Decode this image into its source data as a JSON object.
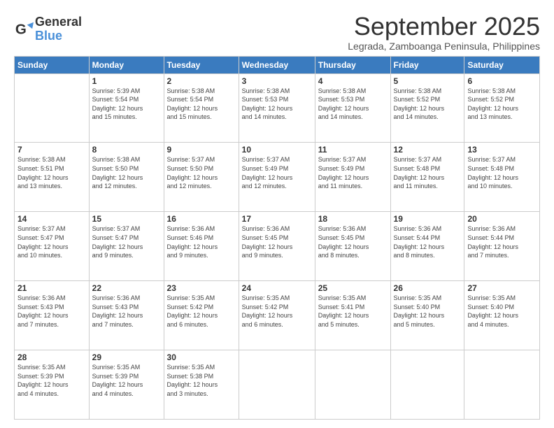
{
  "logo": {
    "line1": "General",
    "line2": "Blue"
  },
  "title": "September 2025",
  "subtitle": "Legrada, Zamboanga Peninsula, Philippines",
  "headers": [
    "Sunday",
    "Monday",
    "Tuesday",
    "Wednesday",
    "Thursday",
    "Friday",
    "Saturday"
  ],
  "weeks": [
    [
      {
        "day": "",
        "info": ""
      },
      {
        "day": "1",
        "info": "Sunrise: 5:39 AM\nSunset: 5:54 PM\nDaylight: 12 hours\nand 15 minutes."
      },
      {
        "day": "2",
        "info": "Sunrise: 5:38 AM\nSunset: 5:54 PM\nDaylight: 12 hours\nand 15 minutes."
      },
      {
        "day": "3",
        "info": "Sunrise: 5:38 AM\nSunset: 5:53 PM\nDaylight: 12 hours\nand 14 minutes."
      },
      {
        "day": "4",
        "info": "Sunrise: 5:38 AM\nSunset: 5:53 PM\nDaylight: 12 hours\nand 14 minutes."
      },
      {
        "day": "5",
        "info": "Sunrise: 5:38 AM\nSunset: 5:52 PM\nDaylight: 12 hours\nand 14 minutes."
      },
      {
        "day": "6",
        "info": "Sunrise: 5:38 AM\nSunset: 5:52 PM\nDaylight: 12 hours\nand 13 minutes."
      }
    ],
    [
      {
        "day": "7",
        "info": "Sunrise: 5:38 AM\nSunset: 5:51 PM\nDaylight: 12 hours\nand 13 minutes."
      },
      {
        "day": "8",
        "info": "Sunrise: 5:38 AM\nSunset: 5:50 PM\nDaylight: 12 hours\nand 12 minutes."
      },
      {
        "day": "9",
        "info": "Sunrise: 5:37 AM\nSunset: 5:50 PM\nDaylight: 12 hours\nand 12 minutes."
      },
      {
        "day": "10",
        "info": "Sunrise: 5:37 AM\nSunset: 5:49 PM\nDaylight: 12 hours\nand 12 minutes."
      },
      {
        "day": "11",
        "info": "Sunrise: 5:37 AM\nSunset: 5:49 PM\nDaylight: 12 hours\nand 11 minutes."
      },
      {
        "day": "12",
        "info": "Sunrise: 5:37 AM\nSunset: 5:48 PM\nDaylight: 12 hours\nand 11 minutes."
      },
      {
        "day": "13",
        "info": "Sunrise: 5:37 AM\nSunset: 5:48 PM\nDaylight: 12 hours\nand 10 minutes."
      }
    ],
    [
      {
        "day": "14",
        "info": "Sunrise: 5:37 AM\nSunset: 5:47 PM\nDaylight: 12 hours\nand 10 minutes."
      },
      {
        "day": "15",
        "info": "Sunrise: 5:37 AM\nSunset: 5:47 PM\nDaylight: 12 hours\nand 9 minutes."
      },
      {
        "day": "16",
        "info": "Sunrise: 5:36 AM\nSunset: 5:46 PM\nDaylight: 12 hours\nand 9 minutes."
      },
      {
        "day": "17",
        "info": "Sunrise: 5:36 AM\nSunset: 5:45 PM\nDaylight: 12 hours\nand 9 minutes."
      },
      {
        "day": "18",
        "info": "Sunrise: 5:36 AM\nSunset: 5:45 PM\nDaylight: 12 hours\nand 8 minutes."
      },
      {
        "day": "19",
        "info": "Sunrise: 5:36 AM\nSunset: 5:44 PM\nDaylight: 12 hours\nand 8 minutes."
      },
      {
        "day": "20",
        "info": "Sunrise: 5:36 AM\nSunset: 5:44 PM\nDaylight: 12 hours\nand 7 minutes."
      }
    ],
    [
      {
        "day": "21",
        "info": "Sunrise: 5:36 AM\nSunset: 5:43 PM\nDaylight: 12 hours\nand 7 minutes."
      },
      {
        "day": "22",
        "info": "Sunrise: 5:36 AM\nSunset: 5:43 PM\nDaylight: 12 hours\nand 7 minutes."
      },
      {
        "day": "23",
        "info": "Sunrise: 5:35 AM\nSunset: 5:42 PM\nDaylight: 12 hours\nand 6 minutes."
      },
      {
        "day": "24",
        "info": "Sunrise: 5:35 AM\nSunset: 5:42 PM\nDaylight: 12 hours\nand 6 minutes."
      },
      {
        "day": "25",
        "info": "Sunrise: 5:35 AM\nSunset: 5:41 PM\nDaylight: 12 hours\nand 5 minutes."
      },
      {
        "day": "26",
        "info": "Sunrise: 5:35 AM\nSunset: 5:40 PM\nDaylight: 12 hours\nand 5 minutes."
      },
      {
        "day": "27",
        "info": "Sunrise: 5:35 AM\nSunset: 5:40 PM\nDaylight: 12 hours\nand 4 minutes."
      }
    ],
    [
      {
        "day": "28",
        "info": "Sunrise: 5:35 AM\nSunset: 5:39 PM\nDaylight: 12 hours\nand 4 minutes."
      },
      {
        "day": "29",
        "info": "Sunrise: 5:35 AM\nSunset: 5:39 PM\nDaylight: 12 hours\nand 4 minutes."
      },
      {
        "day": "30",
        "info": "Sunrise: 5:35 AM\nSunset: 5:38 PM\nDaylight: 12 hours\nand 3 minutes."
      },
      {
        "day": "",
        "info": ""
      },
      {
        "day": "",
        "info": ""
      },
      {
        "day": "",
        "info": ""
      },
      {
        "day": "",
        "info": ""
      }
    ]
  ]
}
